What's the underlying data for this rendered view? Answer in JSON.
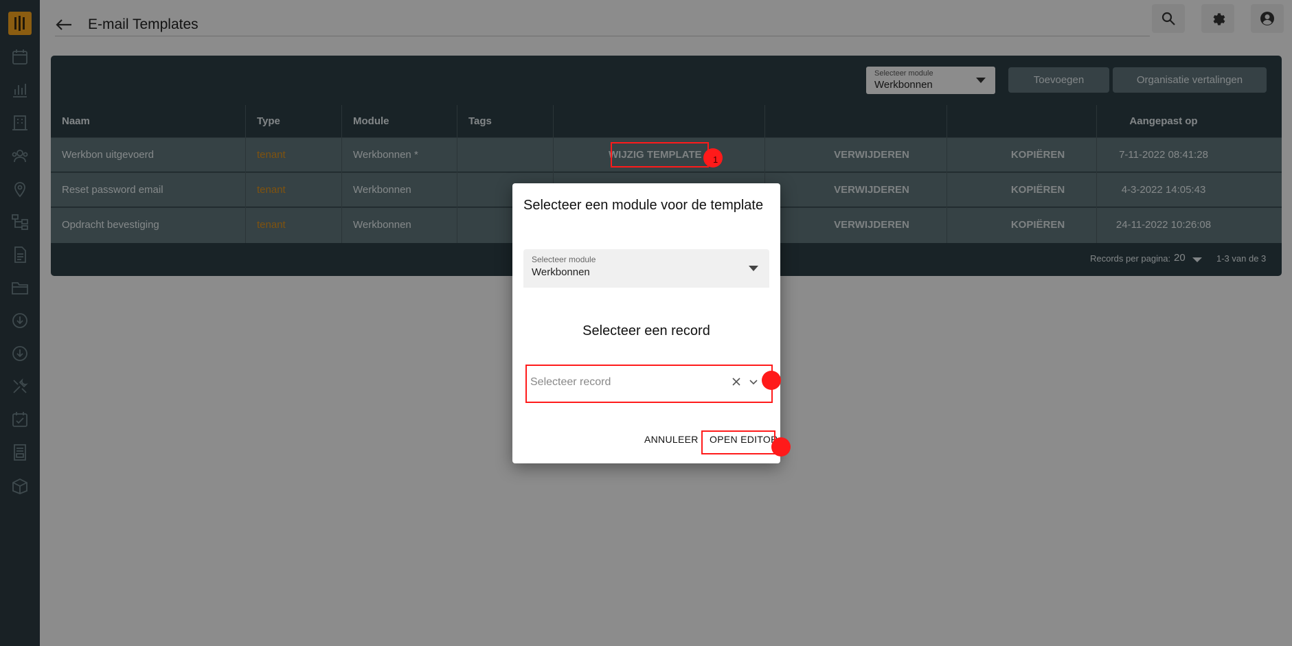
{
  "header": {
    "title": "E-mail Templates"
  },
  "toolbar": {
    "module_select_label": "Selecteer module",
    "module_select_value": "Werkbonnen",
    "add_label": "Toevoegen",
    "translations_label": "Organisatie vertalingen"
  },
  "table": {
    "columns": [
      "Naam",
      "Type",
      "Module",
      "Tags",
      "Aangepast op"
    ],
    "rows": [
      {
        "name": "Werkbon uitgevoerd",
        "type": "tenant",
        "module": "Werkbonnen *",
        "edit": "WIJZIG TEMPLATE",
        "delete": "VERWIJDEREN",
        "copy": "KOPIËREN",
        "modified": "7-11-2022 08:41:28"
      },
      {
        "name": "Reset password email",
        "type": "tenant",
        "module": "Werkbonnen",
        "delete": "VERWIJDEREN",
        "copy": "KOPIËREN",
        "modified": "4-3-2022 14:05:43"
      },
      {
        "name": "Opdracht bevestiging",
        "type": "tenant",
        "module": "Werkbonnen",
        "delete": "VERWIJDEREN",
        "copy": "KOPIËREN",
        "modified": "24-11-2022 10:26:08"
      }
    ],
    "records_per_page_label": "Records per pagina:",
    "records_per_page_value": "20",
    "range_text": "1-3 van de 3"
  },
  "dialog": {
    "title": "Selecteer een module voor de template",
    "module_label": "Selecteer module",
    "module_value": "Werkbonnen",
    "record_heading": "Selecteer een record",
    "record_placeholder": "Selecteer record",
    "cancel_label": "ANNULEER",
    "open_label": "OPEN EDITOR"
  },
  "annotations": {
    "step1": "1"
  },
  "colors": {
    "sidebar": "#2b3a40",
    "accent": "#f0a01e",
    "annotation": "#ff1a1a",
    "type_text": "#d98e1a"
  }
}
